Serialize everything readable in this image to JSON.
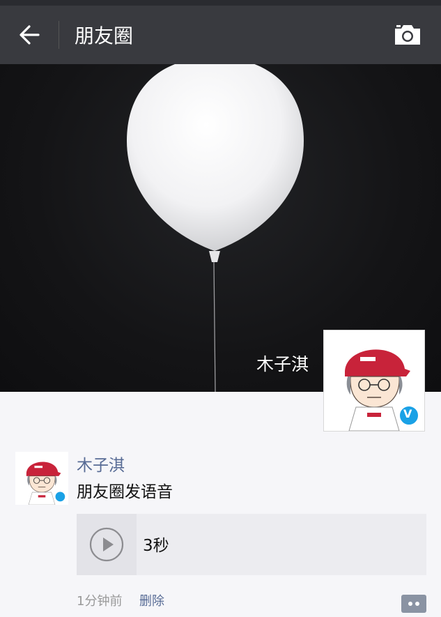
{
  "nav": {
    "title": "朋友圈",
    "back_icon": "arrow-left-icon",
    "camera_icon": "camera-icon",
    "background": "#393a3f"
  },
  "cover": {
    "user_name": "木子淇",
    "verified_badge": "V"
  },
  "post": {
    "author": "木子淇",
    "text": "朋友圈发语音",
    "voice": {
      "duration": "3秒",
      "play_icon": "play-icon"
    },
    "time": "1分钟前",
    "delete_label": "删除",
    "comment_icon": "comment-bubble-icon",
    "author_color": "#576b95"
  }
}
